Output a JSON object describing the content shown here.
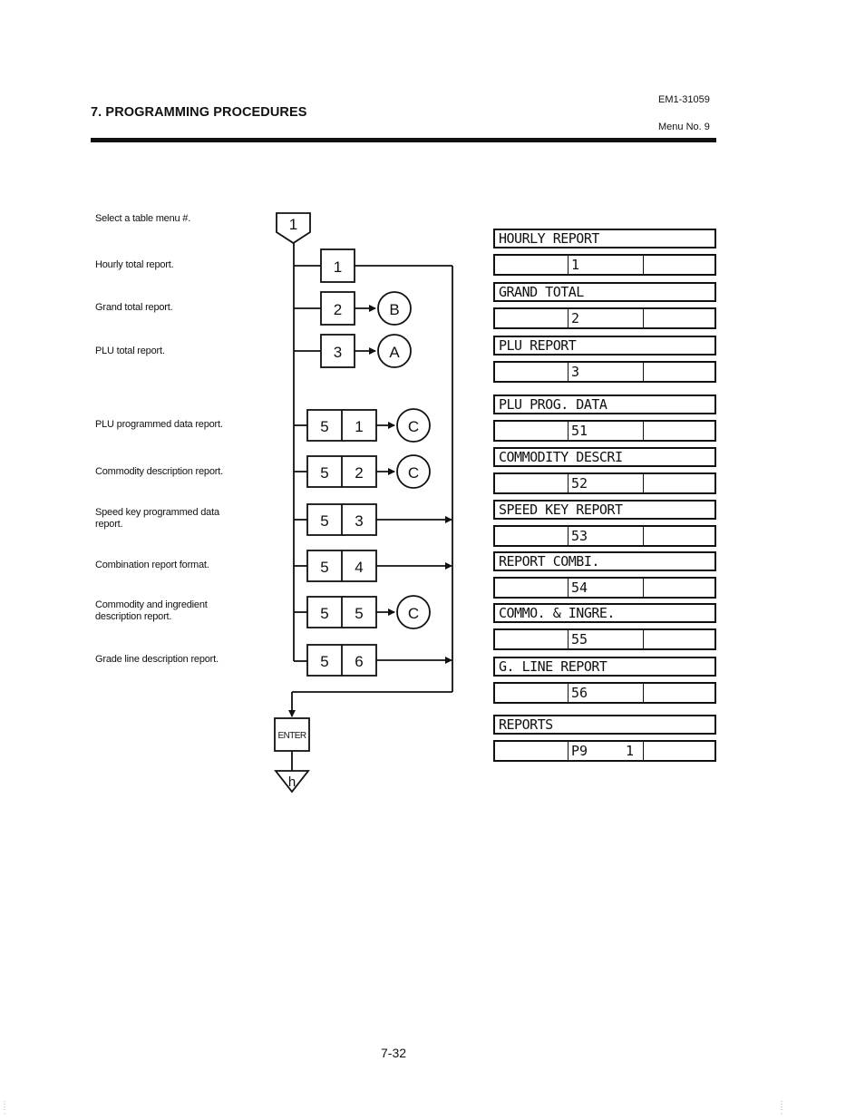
{
  "header": {
    "section_title": "7. PROGRAMMING PROCEDURES",
    "doc_code": "EM1-31059",
    "menu_no": "Menu No. 9"
  },
  "descriptions": [
    "Select a table menu #.",
    "Hourly total report.",
    "Grand total report.",
    "PLU total report.",
    "PLU programmed data report.",
    "Commodity description report.",
    "Speed key programmed data report.",
    "Combination report format.",
    "Commodity and ingredient description report.",
    "Grade line description report."
  ],
  "flowchart": {
    "start_symbol": "1",
    "keys": [
      {
        "digits": [
          "1"
        ],
        "target": ""
      },
      {
        "digits": [
          "2"
        ],
        "target": "B"
      },
      {
        "digits": [
          "3"
        ],
        "target": "A"
      },
      {
        "digits": [
          "5",
          "1"
        ],
        "target": "C"
      },
      {
        "digits": [
          "5",
          "2"
        ],
        "target": "C"
      },
      {
        "digits": [
          "5",
          "3"
        ],
        "target": ""
      },
      {
        "digits": [
          "5",
          "4"
        ],
        "target": ""
      },
      {
        "digits": [
          "5",
          "5"
        ],
        "target": "C"
      },
      {
        "digits": [
          "5",
          "6"
        ],
        "target": ""
      }
    ],
    "enter_key": "ENTER",
    "end_symbol": "h"
  },
  "displays": [
    {
      "title": "HOURLY REPORT",
      "code": "1",
      "extra": ""
    },
    {
      "title": "GRAND TOTAL",
      "code": "2",
      "extra": ""
    },
    {
      "title": "PLU REPORT",
      "code": "3",
      "extra": ""
    },
    {
      "title": "PLU PROG. DATA",
      "code": "51",
      "extra": ""
    },
    {
      "title": "COMMODITY DESCRI",
      "code": "52",
      "extra": ""
    },
    {
      "title": "SPEED KEY REPORT",
      "code": "53",
      "extra": ""
    },
    {
      "title": "REPORT COMBI.",
      "code": "54",
      "extra": ""
    },
    {
      "title": "COMMO. & INGRE.",
      "code": "55",
      "extra": ""
    },
    {
      "title": "G. LINE REPORT",
      "code": "56",
      "extra": ""
    },
    {
      "title": "REPORTS",
      "code": "P9",
      "extra": "1"
    }
  ],
  "footer": {
    "page_number": "7-32"
  }
}
